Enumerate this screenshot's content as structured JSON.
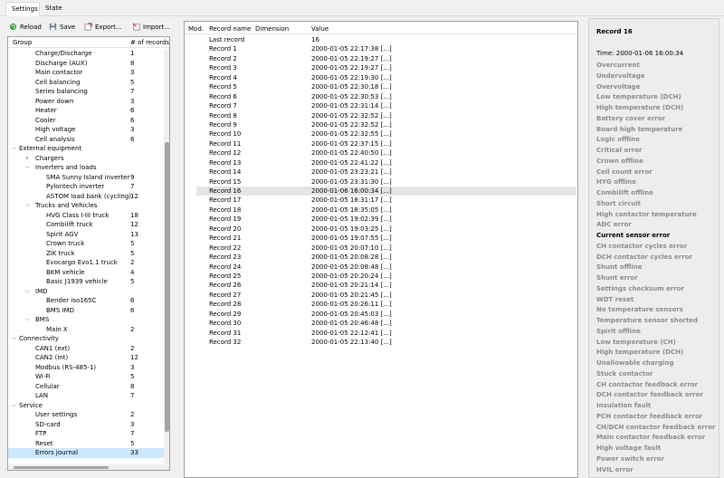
{
  "tabs": [
    {
      "label": "Settings",
      "active": true
    },
    {
      "label": "State",
      "active": false
    }
  ],
  "toolbar": {
    "reload": "Reload",
    "save": "Save",
    "export": "Export...",
    "import": "Import..."
  },
  "tree": {
    "col_group": "Group",
    "col_count": "# of records",
    "rows": [
      {
        "name": "Charge/Discharge",
        "count": "1",
        "indent": 2
      },
      {
        "name": "Discharge (AUX)",
        "count": "8",
        "indent": 2
      },
      {
        "name": "Main contactor",
        "count": "3",
        "indent": 2
      },
      {
        "name": "Cell balancing",
        "count": "5",
        "indent": 2
      },
      {
        "name": "Series balancing",
        "count": "7",
        "indent": 2
      },
      {
        "name": "Power down",
        "count": "3",
        "indent": 2
      },
      {
        "name": "Heater",
        "count": "6",
        "indent": 2
      },
      {
        "name": "Cooler",
        "count": "6",
        "indent": 2
      },
      {
        "name": "High voltage",
        "count": "3",
        "indent": 2
      },
      {
        "name": "Cell analysis",
        "count": "6",
        "indent": 2
      },
      {
        "name": "External equipment",
        "count": "",
        "indent": 1,
        "arrow": "v"
      },
      {
        "name": "Chargers",
        "count": "",
        "indent": 2,
        "arrow": ">"
      },
      {
        "name": "Inverters and loads",
        "count": "",
        "indent": 2,
        "arrow": "v"
      },
      {
        "name": "SMA Sunny Island inverter",
        "count": "9",
        "indent": 3
      },
      {
        "name": "Pylontech inverter",
        "count": "7",
        "indent": 3
      },
      {
        "name": "ASTOM load bank (cycling)",
        "count": "12",
        "indent": 3
      },
      {
        "name": "Trucks and Vehicles",
        "count": "",
        "indent": 2,
        "arrow": "v"
      },
      {
        "name": "HVG Class I-III truck",
        "count": "18",
        "indent": 3
      },
      {
        "name": "Combilift truck",
        "count": "12",
        "indent": 3
      },
      {
        "name": "Spirit AGV",
        "count": "13",
        "indent": 3
      },
      {
        "name": "Crown truck",
        "count": "5",
        "indent": 3
      },
      {
        "name": "ZiK truck",
        "count": "5",
        "indent": 3
      },
      {
        "name": "Evocargo Evo1.1 truck",
        "count": "2",
        "indent": 3
      },
      {
        "name": "BKM vehicle",
        "count": "4",
        "indent": 3
      },
      {
        "name": "Basic J1939 vehicle",
        "count": "5",
        "indent": 3
      },
      {
        "name": "IMD",
        "count": "",
        "indent": 2,
        "arrow": "v"
      },
      {
        "name": "Bender iso165C",
        "count": "6",
        "indent": 3
      },
      {
        "name": "BMS IMD",
        "count": "6",
        "indent": 3
      },
      {
        "name": "BMS",
        "count": "",
        "indent": 2,
        "arrow": "v"
      },
      {
        "name": "Main X",
        "count": "2",
        "indent": 3
      },
      {
        "name": "Connectivity",
        "count": "",
        "indent": 1,
        "arrow": "v"
      },
      {
        "name": "CAN1 (ext)",
        "count": "2",
        "indent": 2
      },
      {
        "name": "CAN2 (int)",
        "count": "12",
        "indent": 2
      },
      {
        "name": "Modbus (RS-485-1)",
        "count": "3",
        "indent": 2
      },
      {
        "name": "Wi-Fi",
        "count": "5",
        "indent": 2
      },
      {
        "name": "Cellular",
        "count": "8",
        "indent": 2
      },
      {
        "name": "LAN",
        "count": "7",
        "indent": 2
      },
      {
        "name": "Service",
        "count": "",
        "indent": 1,
        "arrow": "v"
      },
      {
        "name": "User settings",
        "count": "2",
        "indent": 2
      },
      {
        "name": "SD-card",
        "count": "3",
        "indent": 2
      },
      {
        "name": "FTP",
        "count": "7",
        "indent": 2
      },
      {
        "name": "Reset",
        "count": "5",
        "indent": 2
      },
      {
        "name": "Errors journal",
        "count": "33",
        "indent": 2,
        "selected": true
      }
    ]
  },
  "records": {
    "col_mod": "Mod.",
    "col_name": "Record name",
    "col_dim": "Dimension",
    "col_value": "Value",
    "rows": [
      {
        "name": "Last record",
        "value": "16"
      },
      {
        "name": "Record 1",
        "value": "2000-01-05 22:17:38 [...]"
      },
      {
        "name": "Record 2",
        "value": "2000-01-05 22:19:27 [...]"
      },
      {
        "name": "Record 3",
        "value": "2000-01-05 22:19:27 [...]"
      },
      {
        "name": "Record 4",
        "value": "2000-01-05 22:19:30 [...]"
      },
      {
        "name": "Record 5",
        "value": "2000-01-05 22:30:18 [...]"
      },
      {
        "name": "Record 6",
        "value": "2000-01-05 22:30:53 [...]"
      },
      {
        "name": "Record 7",
        "value": "2000-01-05 22:31:14 [...]"
      },
      {
        "name": "Record 8",
        "value": "2000-01-05 22:32:52 [...]"
      },
      {
        "name": "Record 9",
        "value": "2000-01-05 22:32:52 [...]"
      },
      {
        "name": "Record 10",
        "value": "2000-01-05 22:32:55 [...]"
      },
      {
        "name": "Record 11",
        "value": "2000-01-05 22:37:15 [...]"
      },
      {
        "name": "Record 12",
        "value": "2000-01-05 22:40:50 [...]"
      },
      {
        "name": "Record 13",
        "value": "2000-01-05 22:41:22 [...]"
      },
      {
        "name": "Record 14",
        "value": "2000-01-05 23:23:21 [...]"
      },
      {
        "name": "Record 15",
        "value": "2000-01-05 23:31:30 [...]"
      },
      {
        "name": "Record 16",
        "value": "2000-01-06 16:00:34 [...]",
        "selected": true
      },
      {
        "name": "Record 17",
        "value": "2000-01-05 18:31:17 [...]"
      },
      {
        "name": "Record 18",
        "value": "2000-01-05 18:35:05 [...]"
      },
      {
        "name": "Record 19",
        "value": "2000-01-05 19:02:39 [...]"
      },
      {
        "name": "Record 20",
        "value": "2000-01-05 19:03:25 [...]"
      },
      {
        "name": "Record 21",
        "value": "2000-01-05 19:07:55 [...]"
      },
      {
        "name": "Record 22",
        "value": "2000-01-05 20:07:10 [...]"
      },
      {
        "name": "Record 23",
        "value": "2000-01-05 20:08:28 [...]"
      },
      {
        "name": "Record 24",
        "value": "2000-01-05 20:08:48 [...]"
      },
      {
        "name": "Record 25",
        "value": "2000-01-05 20:20:24 [...]"
      },
      {
        "name": "Record 26",
        "value": "2000-01-05 20:21:14 [...]"
      },
      {
        "name": "Record 27",
        "value": "2000-01-05 20:21:45 [...]"
      },
      {
        "name": "Record 28",
        "value": "2000-01-05 20:26:11 [...]"
      },
      {
        "name": "Record 29",
        "value": "2000-01-05 20:45:03 [...]"
      },
      {
        "name": "Record 30",
        "value": "2000-01-05 20:46:48 [...]"
      },
      {
        "name": "Record 31",
        "value": "2000-01-05 22:12:41 [...]"
      },
      {
        "name": "Record 32",
        "value": "2000-01-05 22:13:40 [...]"
      }
    ]
  },
  "detail": {
    "title": "Record 16",
    "time_label": "Time:",
    "time_value": "2000-01-06 16:00:34",
    "items": [
      {
        "label": "Overcurrent",
        "active": false
      },
      {
        "label": "Undervoltage",
        "active": false
      },
      {
        "label": "Overvoltage",
        "active": false
      },
      {
        "label": "Low temperature (DCH)",
        "active": false
      },
      {
        "label": "High temperature (DCH)",
        "active": false
      },
      {
        "label": "Battery cover error",
        "active": false
      },
      {
        "label": "Board high temperature",
        "active": false
      },
      {
        "label": "Logic offline",
        "active": false
      },
      {
        "label": "Critical error",
        "active": false
      },
      {
        "label": "Crown offline",
        "active": false
      },
      {
        "label": "Cell count error",
        "active": false
      },
      {
        "label": "HYG offline",
        "active": false
      },
      {
        "label": "Combilift offline",
        "active": false
      },
      {
        "label": "Short circuit",
        "active": false
      },
      {
        "label": "High contactor temperature",
        "active": false
      },
      {
        "label": "ADC error",
        "active": false
      },
      {
        "label": "Current sensor error",
        "active": true
      },
      {
        "label": "CH contactor cycles error",
        "active": false
      },
      {
        "label": "DCH contactor cycles error",
        "active": false
      },
      {
        "label": "Shunt offline",
        "active": false
      },
      {
        "label": "Shunt error",
        "active": false
      },
      {
        "label": "Settings checksum error",
        "active": false
      },
      {
        "label": "WDT reset",
        "active": false
      },
      {
        "label": "No temperature sensors",
        "active": false
      },
      {
        "label": "Temperature sensor shorted",
        "active": false
      },
      {
        "label": "Spirit offline",
        "active": false
      },
      {
        "label": "Low temperature (CH)",
        "active": false
      },
      {
        "label": "High temperature (DCH)",
        "active": false
      },
      {
        "label": "Unallowable charging",
        "active": false
      },
      {
        "label": "Stuck contactor",
        "active": false
      },
      {
        "label": "CH contactor feedback error",
        "active": false
      },
      {
        "label": "DCH contactor feedback error",
        "active": false
      },
      {
        "label": "Insulation fault",
        "active": false
      },
      {
        "label": "PCH contactor feedback error",
        "active": false
      },
      {
        "label": "CH/DCH contactor feedback error",
        "active": false
      },
      {
        "label": "Main contactor feedback error",
        "active": false
      },
      {
        "label": "High voltage fault",
        "active": false
      },
      {
        "label": "Power switch error",
        "active": false
      },
      {
        "label": "HVIL error",
        "active": false
      }
    ]
  }
}
